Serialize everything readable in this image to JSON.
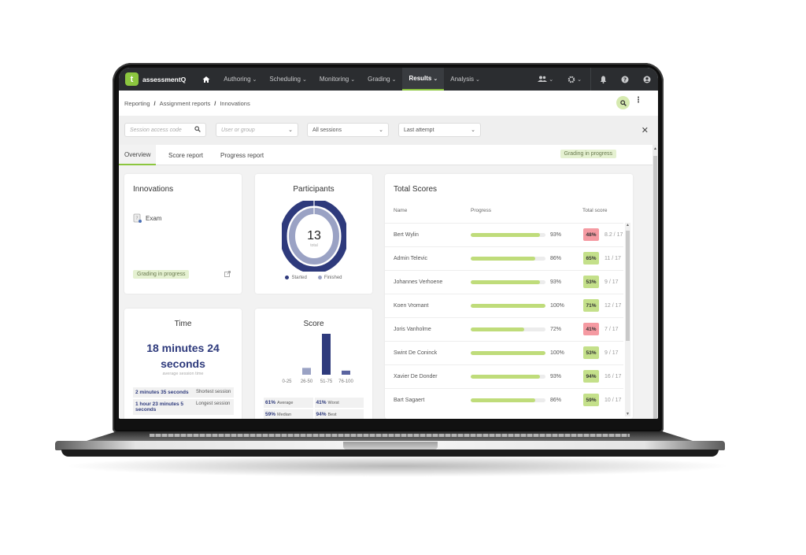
{
  "app": {
    "logo_letter": "t",
    "name": "assessmentQ",
    "accent": "#8cc63f",
    "nav_bg": "#2b2d30"
  },
  "nav": {
    "items": [
      {
        "label": "Authoring",
        "active": false
      },
      {
        "label": "Scheduling",
        "active": false
      },
      {
        "label": "Monitoring",
        "active": false
      },
      {
        "label": "Grading",
        "active": false
      },
      {
        "label": "Results",
        "active": true
      },
      {
        "label": "Analysis",
        "active": false
      }
    ],
    "icons": [
      "users-icon",
      "gear-icon",
      "bell-icon",
      "help-icon",
      "account-icon"
    ]
  },
  "breadcrumb": [
    "Reporting",
    "Assignment reports",
    "Innovations"
  ],
  "filters": {
    "session_code_placeholder": "Session access code",
    "user_group_placeholder": "User or group",
    "sessions_value": "All sessions",
    "attempt_value": "Last attempt"
  },
  "tabs": [
    {
      "label": "Overview",
      "active": true
    },
    {
      "label": "Score report",
      "active": false
    },
    {
      "label": "Progress report",
      "active": false
    }
  ],
  "status_badge": "Grading in progress",
  "innovations_card": {
    "title": "Innovations",
    "item": "Exam",
    "status": "Grading in progress"
  },
  "participants_card": {
    "title": "Participants",
    "total": "13",
    "total_label": "total",
    "legend": [
      {
        "label": "Started",
        "color": "#2e3a7c"
      },
      {
        "label": "Finished",
        "color": "#9aa2c4"
      }
    ]
  },
  "time_card": {
    "title": "Time",
    "average_line1": "18 minutes 24",
    "average_line2": "seconds",
    "average_label": "average session time",
    "rows": [
      {
        "value": "2 minutes 35 seconds",
        "label": "Shortest session"
      },
      {
        "value": "1 hour 23 minutes 5 seconds",
        "label": "Longest session"
      }
    ]
  },
  "score_card": {
    "title": "Score",
    "stats": [
      {
        "value": "61%",
        "label": "Average"
      },
      {
        "value": "41%",
        "label": "Worst"
      },
      {
        "value": "59%",
        "label": "Median"
      },
      {
        "value": "94%",
        "label": "Best"
      }
    ]
  },
  "chart_data": {
    "type": "bar",
    "title": "Score",
    "categories": [
      "0-25",
      "26-50",
      "51-75",
      "76-100"
    ],
    "values": [
      0,
      1,
      6,
      0.6
    ],
    "xlabel": "",
    "ylabel": "",
    "colors": [
      "#9aa2c4",
      "#9aa2c4",
      "#2e3a7c",
      "#5a64a0"
    ],
    "grid": false
  },
  "total_scores": {
    "title": "Total Scores",
    "columns": [
      "Name",
      "Progress",
      "Total score"
    ],
    "rows": [
      {
        "name": "Bert Wylin",
        "progress": 93,
        "progress_label": "93%",
        "score": "48%",
        "pass": false,
        "fraction": "8.2 / 17"
      },
      {
        "name": "Admin Televic",
        "progress": 86,
        "progress_label": "86%",
        "score": "65%",
        "pass": true,
        "fraction": "11 / 17"
      },
      {
        "name": "Johannes Verhoene",
        "progress": 93,
        "progress_label": "93%",
        "score": "53%",
        "pass": true,
        "fraction": "9 / 17"
      },
      {
        "name": "Koen Vromant",
        "progress": 100,
        "progress_label": "100%",
        "score": "71%",
        "pass": true,
        "fraction": "12 / 17"
      },
      {
        "name": "Joris Vanholme",
        "progress": 72,
        "progress_label": "72%",
        "score": "41%",
        "pass": false,
        "fraction": "7 / 17"
      },
      {
        "name": "Swint De Coninck",
        "progress": 100,
        "progress_label": "100%",
        "score": "53%",
        "pass": true,
        "fraction": "9 / 17"
      },
      {
        "name": "Xavier De Donder",
        "progress": 93,
        "progress_label": "93%",
        "score": "94%",
        "pass": true,
        "fraction": "16 / 17"
      },
      {
        "name": "Bart Sagaert",
        "progress": 86,
        "progress_label": "86%",
        "score": "59%",
        "pass": true,
        "fraction": "10 / 17"
      }
    ],
    "pass_color": "#c4e08a",
    "fail_color": "#f59aa2"
  }
}
